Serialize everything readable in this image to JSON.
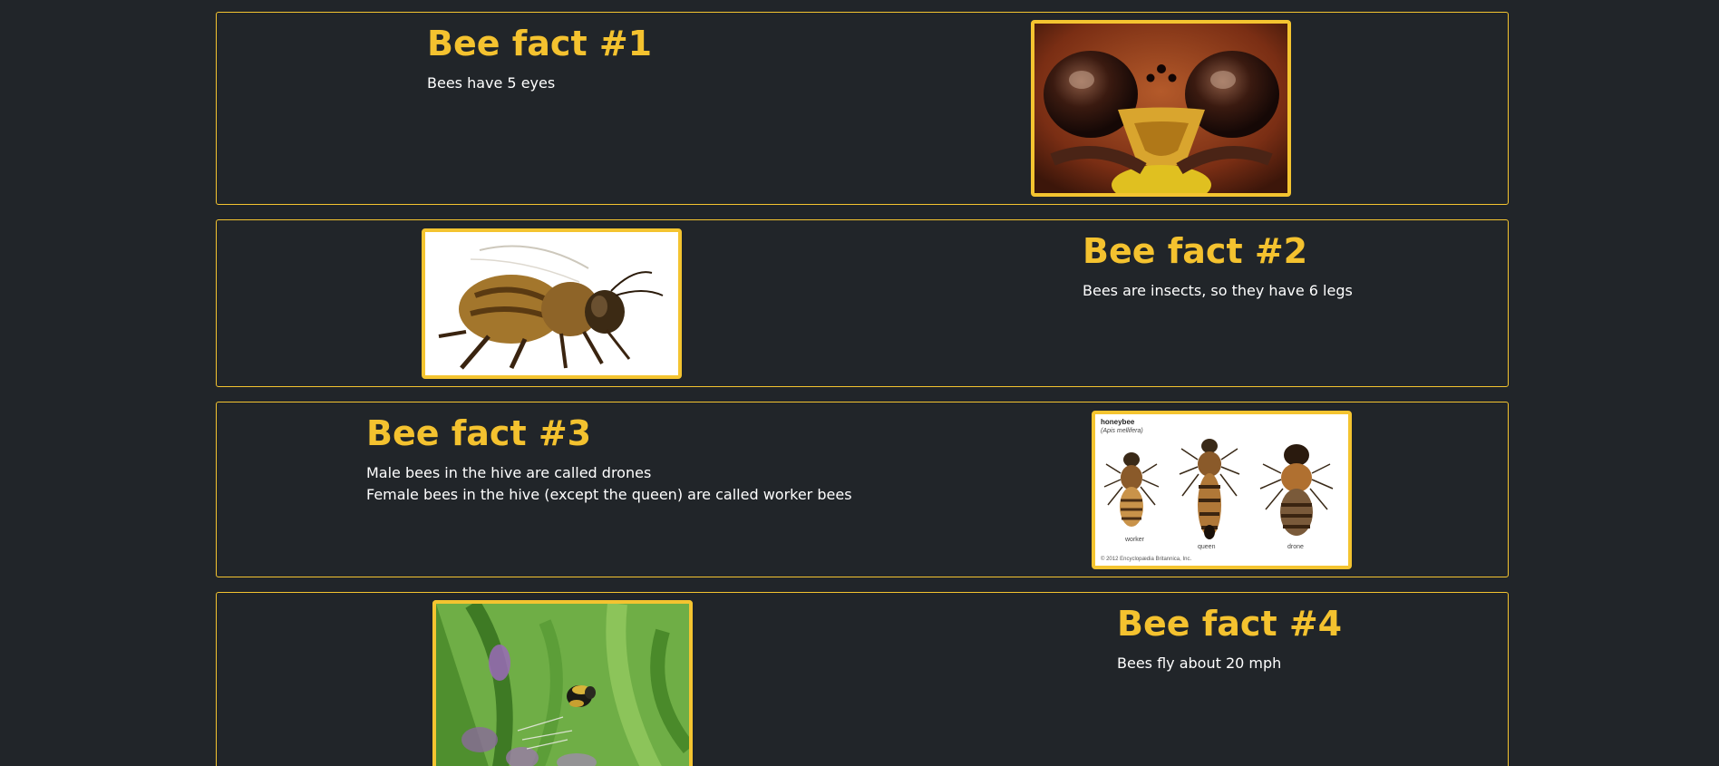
{
  "facts": [
    {
      "title": "Bee fact #1",
      "lines": [
        "Bees have 5 eyes"
      ],
      "image": "bee-face-closeup-photo"
    },
    {
      "title": "Bee fact #2",
      "lines": [
        "Bees are insects, so they have 6 legs"
      ],
      "image": "honeybee-side-photo"
    },
    {
      "title": "Bee fact #3",
      "lines": [
        "Male bees in the hive are called drones",
        "Female bees in the hive (except the queen) are called worker bees"
      ],
      "image": "honeybee-castes-illustration",
      "image_text": {
        "heading": "honeybee",
        "subheading": "(Apis mellifera)",
        "labels": [
          "worker",
          "queen",
          "drone"
        ],
        "credit": "© 2012 Encyclopædia Britannica, Inc."
      }
    },
    {
      "title": "Bee fact #4",
      "lines": [
        "Bees fly about 20 mph"
      ],
      "image": "bumblebee-on-flowers-photo"
    }
  ],
  "colors": {
    "background": "#212529",
    "accent": "#f4c22f",
    "text": "#ffffff"
  }
}
